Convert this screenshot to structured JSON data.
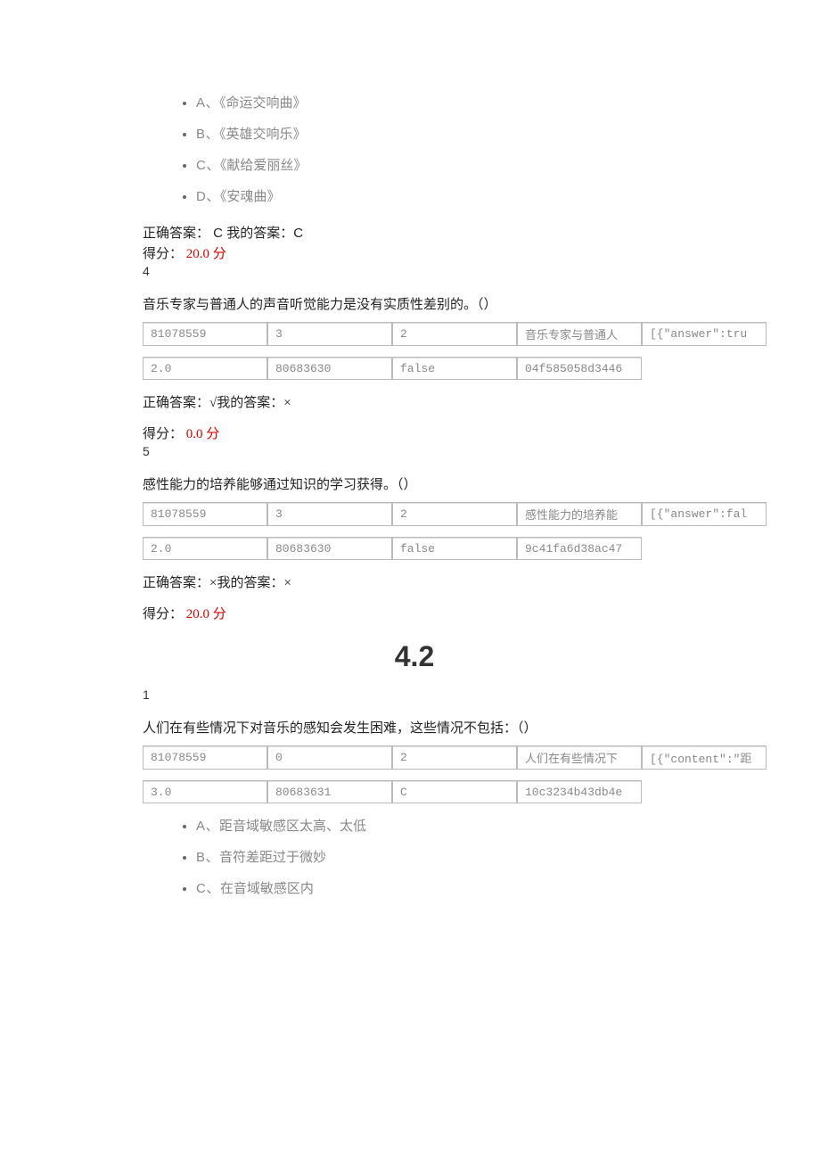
{
  "q3": {
    "options": [
      {
        "letter": "A、",
        "text": "《命运交响曲》"
      },
      {
        "letter": "B、",
        "text": "《英雄交响乐》"
      },
      {
        "letter": "C、",
        "text": "《献给爱丽丝》"
      },
      {
        "letter": "D、",
        "text": "《安魂曲》"
      }
    ],
    "correct_label": "正确答案：",
    "correct_value": " C ",
    "my_label": "我的答案：",
    "my_value": "C",
    "score_label": "得分：",
    "score_value": " 20.0 ",
    "score_unit": "分"
  },
  "q4": {
    "num": "4",
    "text": "音乐专家与普通人的声音听觉能力是没有实质性差别的。（）",
    "table1": [
      "81078559",
      "3",
      "2",
      "音乐专家与普通人",
      "[{\"answer\":tru"
    ],
    "table2": [
      "2.0",
      "80683630",
      "false",
      "04f585058d3446",
      ""
    ],
    "correct_label": "正确答案：",
    "correct_value": "√",
    "my_label": "我的答案：",
    "my_value": "×",
    "score_label": "得分：",
    "score_value": " 0.0 ",
    "score_unit": "分"
  },
  "q5": {
    "num": "5",
    "text": "感性能力的培养能够通过知识的学习获得。（）",
    "table1": [
      "81078559",
      "3",
      "2",
      "感性能力的培养能",
      "[{\"answer\":fal"
    ],
    "table2": [
      "2.0",
      "80683630",
      "false",
      "9c41fa6d38ac47",
      ""
    ],
    "correct_label": "正确答案：",
    "correct_value": "×",
    "my_label": "我的答案：",
    "my_value": "×",
    "score_label": "得分：",
    "score_value": " 20.0 ",
    "score_unit": "分"
  },
  "section": "4.2",
  "s1": {
    "num": "1",
    "text": "人们在有些情况下对音乐的感知会发生困难，这些情况不包括：（）",
    "table1": [
      "81078559",
      "0",
      "2",
      "人们在有些情况下",
      "[{\"content\":\"距"
    ],
    "table2": [
      "3.0",
      "80683631",
      "C",
      "10c3234b43db4e",
      ""
    ],
    "options": [
      {
        "letter": "A、",
        "text": "距音域敏感区太高、太低"
      },
      {
        "letter": "B、",
        "text": "音符差距过于微妙"
      },
      {
        "letter": "C、",
        "text": "在音域敏感区内"
      }
    ]
  }
}
